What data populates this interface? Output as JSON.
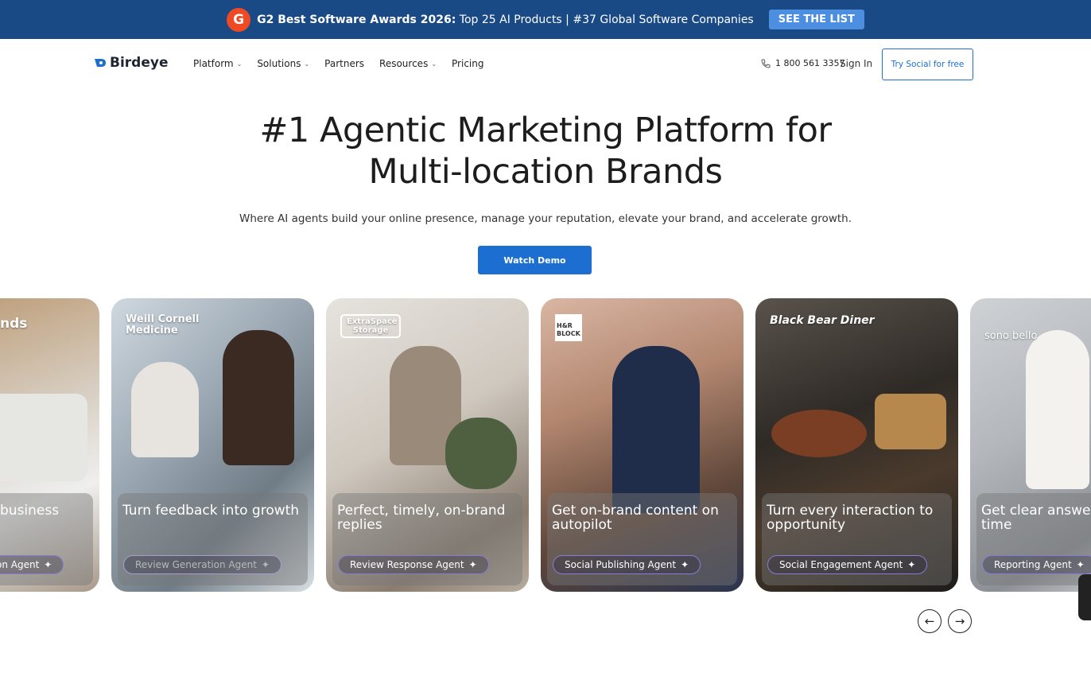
{
  "banner": {
    "badge": "G",
    "bold_text": "G2 Best Software Awards 2026:",
    "text": " Top 25 AI Products | #37 Global Software Companies",
    "cta": "SEE THE LIST"
  },
  "nav": {
    "logo": "Birdeye",
    "menu": [
      {
        "label": "Platform",
        "has_dropdown": true
      },
      {
        "label": "Solutions",
        "has_dropdown": true
      },
      {
        "label": "Partners",
        "has_dropdown": false
      },
      {
        "label": "Resources",
        "has_dropdown": true
      },
      {
        "label": "Pricing",
        "has_dropdown": false
      }
    ],
    "phone": "1 800 561 3357",
    "sign_in": "Sign In",
    "try_button": "Try Social for free"
  },
  "hero": {
    "title_line1": "#1 Agentic Marketing Platform for",
    "title_line2": "Multi-location Brands",
    "subtitle": "Where AI agents build your online presence, manage your reputation, elevate your brand, and accelerate growth.",
    "cta": "Watch Demo"
  },
  "cards": [
    {
      "brand": "nds",
      "headline": "business",
      "agent": "on Agent",
      "bg": "#c9b59a"
    },
    {
      "brand": "Weill Cornell Medicine",
      "headline": "Turn feedback into growth",
      "agent": "Review Generation Agent",
      "bg": "#aeb9c4"
    },
    {
      "brand": "ExtraSpace Storage",
      "headline": "Perfect, timely, on-brand replies",
      "agent": "Review Response Agent",
      "bg": "#c8c2bb"
    },
    {
      "brand": "H&R BLOCK",
      "headline": "Get on-brand content on autopilot",
      "agent": "Social Publishing Agent",
      "bg": "#8c6f62"
    },
    {
      "brand": "Black Bear Diner",
      "headline": "Turn every interaction to opportunity",
      "agent": "Social Engagement Agent",
      "bg": "#3f3a35"
    },
    {
      "brand": "sono bello",
      "headline": "Get clear answe time",
      "agent": "Reporting Agent",
      "bg": "#c7c9cc"
    }
  ],
  "carousel": {
    "prev": "←",
    "next": "→"
  }
}
